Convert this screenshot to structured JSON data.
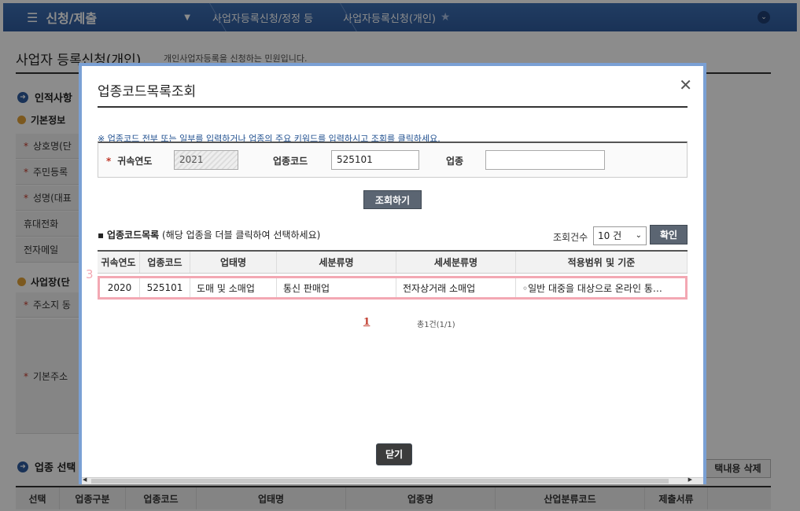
{
  "topbar": {
    "menu_label": "신청/제출",
    "crumbs": [
      "사업자등록신청/정정 등",
      "사업자등록신청(개인)"
    ]
  },
  "page": {
    "title": "사업자 등록신청(개인)",
    "subtitle": "개인사업자등록을 신청하는 민원입니다.",
    "section_personal": "인적사항",
    "subsection_basic": "기본정보",
    "rows": [
      "상호명(단",
      "주민등록",
      "성명(대표",
      "휴대전화",
      "전자메일"
    ],
    "section_business": "사업장(단",
    "row_address": "주소지 동",
    "row_base_address": "기본주소",
    "section_industry": "업종 선택",
    "delete_button": "택내용 삭제",
    "table_headers": [
      "선택",
      "업종구분",
      "업종코드",
      "업태명",
      "업종명",
      "산업분류코드",
      "제출서류"
    ]
  },
  "modal": {
    "title": "업종코드목록조회",
    "close_glyph": "✕",
    "note": "※ 업종코드 전부 또는 일부를 입력하거나 업종의 주요 키워드를 입력하시고 조회를 클릭하세요.",
    "search": {
      "year_label": "귀속연도",
      "year_value": "2021",
      "code_label": "업종코드",
      "code_value": "525101",
      "industry_label": "업종",
      "industry_value": ""
    },
    "search_button": "조회하기",
    "list_title": "업종코드목록",
    "list_hint": "(해당 업종을 더블 클릭하여 선택하세요)",
    "count_label": "조회건수",
    "count_value": "10 건",
    "confirm_button": "확인",
    "columns": [
      "귀속연도",
      "업종코드",
      "업태명",
      "세분류명",
      "세세분류명",
      "적용범위 및 기준"
    ],
    "rows": [
      [
        "2020",
        "525101",
        "도매 및 소매업",
        "통신 판매업",
        "전자상거래 소매업",
        "◦일반 대중을 대상으로 온라인 통…"
      ]
    ],
    "annotation_number": "3",
    "page_number": "1",
    "total_text": "총1건(1/1)",
    "close_button": "닫기"
  }
}
